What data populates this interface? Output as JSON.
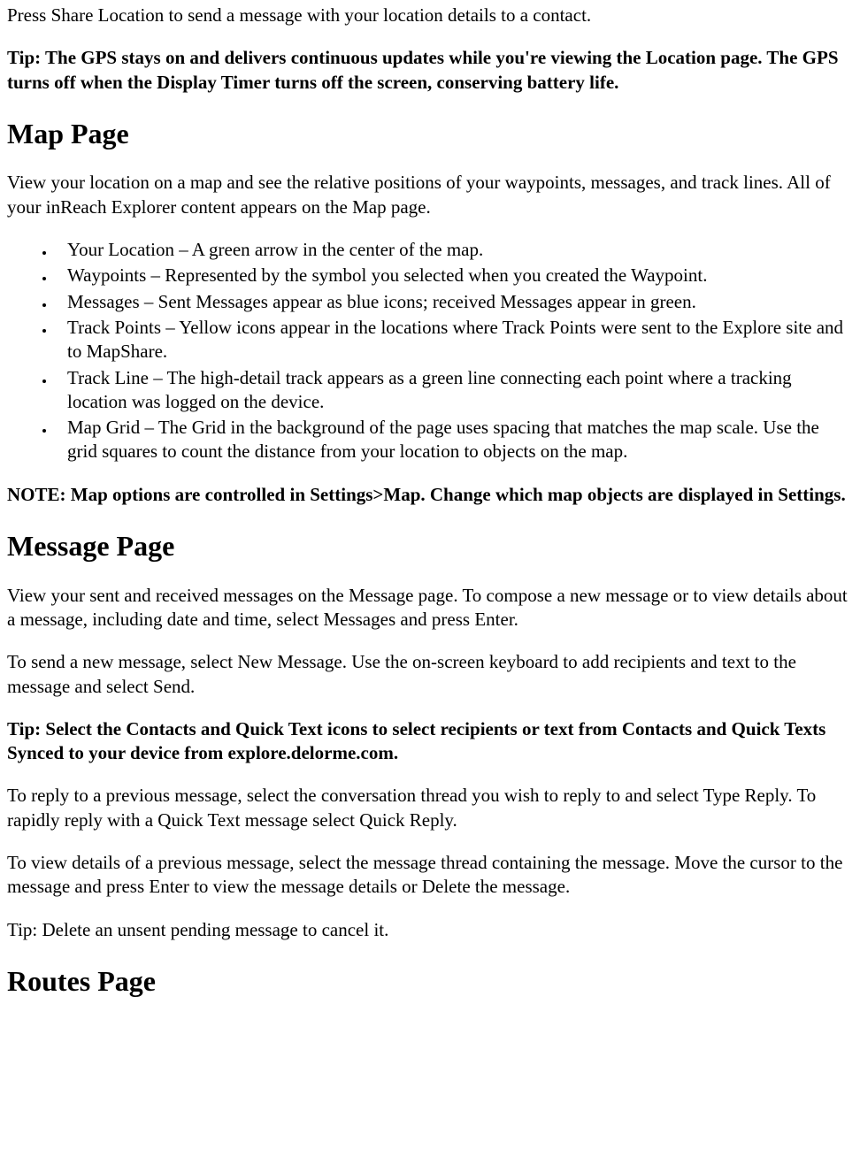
{
  "p1": "Press Share Location to send a message with your location details to a contact.",
  "p2": "Tip: The GPS stays on and delivers continuous updates while you're viewing the Location page. The GPS turns off when the Display Timer turns off the screen, conserving battery life.",
  "h1": "Map Page",
  "p3": "View your location on a map and see the relative positions of your waypoints, messages, and track lines. All of your inReach Explorer content appears on the Map page.",
  "list1": [
    "Your Location – A green arrow in the center of the map.",
    "Waypoints – Represented by the symbol you selected when you created the Waypoint.",
    "Messages – Sent Messages appear as blue icons; received Messages appear in green.",
    "Track Points – Yellow icons appear in the locations where Track Points were sent to the Explore site and to MapShare.",
    "Track Line – The high-detail track appears as a green line connecting each point where a tracking location was logged on the device.",
    "Map Grid – The Grid in the background of the page uses spacing that matches the map scale. Use the grid squares to count the distance from your location to objects on the map."
  ],
  "p4": "NOTE: Map options are controlled in Settings>Map. Change which map objects are displayed in Settings.",
  "h2": "Message Page",
  "p5": "View your sent and received messages on the Message page. To compose a new message or to view details about a message, including date and time, select Messages and press Enter.",
  "p6": "To send a new message, select New Message. Use the on-screen keyboard to add recipients and text to the message and select Send.",
  "p7": "Tip: Select the Contacts and Quick Text icons to select recipients or text from Contacts and Quick Texts Synced to your device from explore.delorme.com.",
  "p8": "To reply to a previous message, select the conversation thread you wish to reply to and select Type Reply. To rapidly reply with a Quick Text message select Quick Reply.",
  "p9": "To view details of a previous message, select the message thread containing the message. Move the cursor to the message and press Enter to view the message details or Delete the message.",
  "p10": "Tip: Delete an unsent pending message to cancel it.",
  "h3": "Routes Page"
}
